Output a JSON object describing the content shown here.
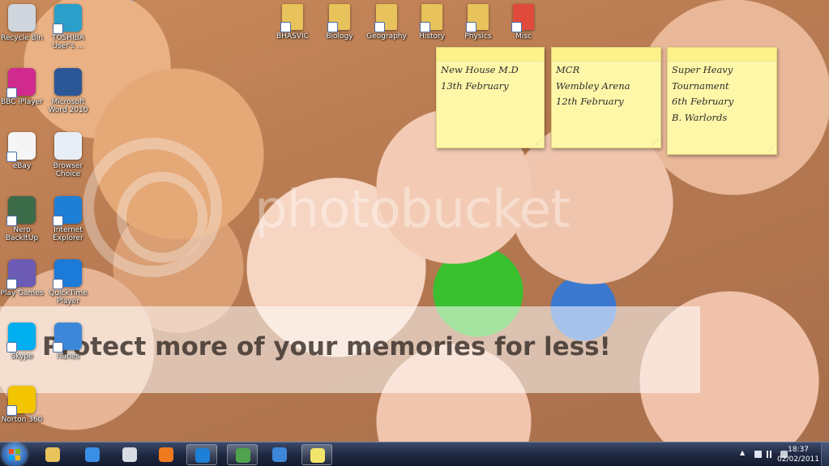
{
  "desktop_icons": [
    {
      "label": "Recycle Bin",
      "icon": "recycle-bin-icon",
      "color": "#cfd6de"
    },
    {
      "label": "TOSHIBA User's ...",
      "icon": "manual-book-icon",
      "color": "#2a9fc9"
    },
    {
      "label": "BBC iPlayer",
      "icon": "bbc-iplayer-icon",
      "color": "#d12a8f"
    },
    {
      "label": "Microsoft Word 2010",
      "icon": "word-icon",
      "color": "#2b5797"
    },
    {
      "label": "eBay",
      "icon": "ebay-icon",
      "color": "#f5f5f5"
    },
    {
      "label": "Browser Choice",
      "icon": "browser-choice-icon",
      "color": "#e8eef6"
    },
    {
      "label": "Nero BackItUp",
      "icon": "nero-backitup-icon",
      "color": "#3c6b4a"
    },
    {
      "label": "Internet Explorer",
      "icon": "internet-explorer-icon",
      "color": "#1e7fd6"
    },
    {
      "label": "Play Games",
      "icon": "play-games-icon",
      "color": "#6c5bb4"
    },
    {
      "label": "QuickTime Player",
      "icon": "quicktime-icon",
      "color": "#1c7ad9"
    },
    {
      "label": "Skype",
      "icon": "skype-icon",
      "color": "#00aff0"
    },
    {
      "label": "iTunes",
      "icon": "itunes-icon",
      "color": "#3d87d9"
    },
    {
      "label": "Norton 360",
      "icon": "norton-icon",
      "color": "#f3c400"
    }
  ],
  "folder_icons": [
    {
      "label": "BHASVIC",
      "icon": "folder-icon",
      "color": "#e8c25a"
    },
    {
      "label": "Biology",
      "icon": "folder-documents-icon",
      "color": "#e8c25a"
    },
    {
      "label": "Geography",
      "icon": "folder-documents-icon",
      "color": "#e8c25a"
    },
    {
      "label": "History",
      "icon": "folder-documents-icon",
      "color": "#e8c25a"
    },
    {
      "label": "Physics",
      "icon": "folder-documents-icon",
      "color": "#e8c25a"
    },
    {
      "label": "Misc",
      "icon": "pdf-file-icon",
      "color": "#e04a3c"
    }
  ],
  "sticky_notes": [
    {
      "lines": [
        "New House M.D",
        "13th February"
      ]
    },
    {
      "lines": [
        "MCR",
        "Wembley Arena",
        "12th February"
      ]
    },
    {
      "lines": [
        "Super Heavy",
        "Tournament",
        "6th February",
        "B. Warlords"
      ]
    }
  ],
  "watermark": {
    "brand": "photobucket",
    "banner": "Protect more of your memories for less!"
  },
  "taskbar": {
    "apps": [
      {
        "name": "Windows Explorer",
        "icon": "folder-icon",
        "color": "#e8c25a"
      },
      {
        "name": "Windows Live Messenger",
        "icon": "messenger-icon",
        "color": "#3a8ee6"
      },
      {
        "name": "Clock",
        "icon": "clock-icon",
        "color": "#d8dce3"
      },
      {
        "name": "Windows Media Player",
        "icon": "media-player-icon",
        "color": "#f07b1f"
      },
      {
        "name": "Internet Explorer",
        "icon": "internet-explorer-icon",
        "color": "#1e7fd6"
      },
      {
        "name": "Windows Live",
        "icon": "people-icon",
        "color": "#4fa34c"
      },
      {
        "name": "iTunes",
        "icon": "itunes-icon",
        "color": "#3d87d9"
      },
      {
        "name": "Sticky Notes",
        "icon": "sticky-notes-icon",
        "color": "#f2e46a"
      }
    ],
    "clock": {
      "time": "18:37",
      "date": "02/02/2011"
    }
  }
}
